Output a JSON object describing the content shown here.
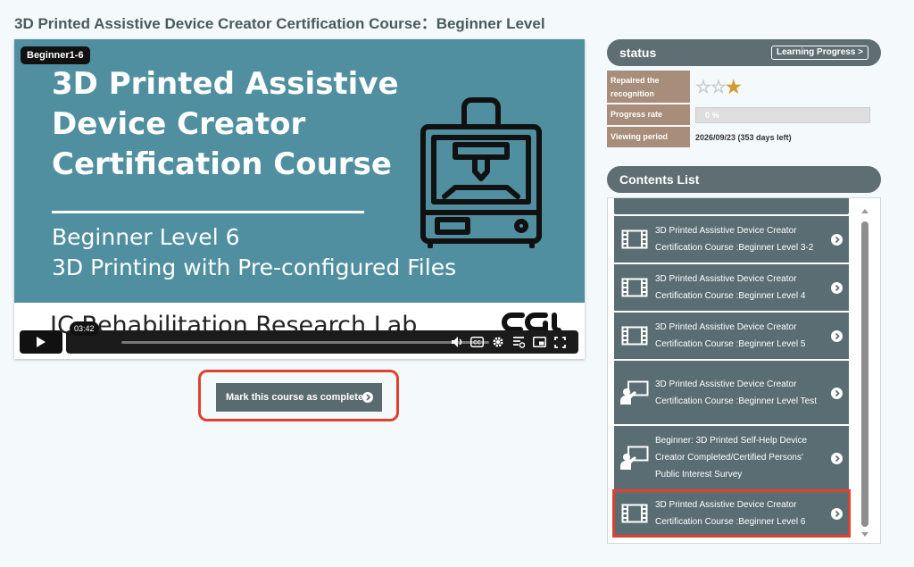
{
  "page": {
    "title": "3D Printed Assistive Device Creator Certification Course：Beginner Level"
  },
  "video": {
    "badge": "Beginner1-6",
    "slide_title": "3D Printed Assistive Device Creator Certification Course",
    "slide_subtitle_1": "Beginner Level 6",
    "slide_subtitle_2": "3D Printing with Pre-configured Files",
    "lab_name": "IC Rehabilitation Research Lab",
    "time": "03:42",
    "icons": [
      "play-icon",
      "volume-icon",
      "captions-icon",
      "settings-gear-icon",
      "watch-later-icon",
      "pip-icon",
      "fullscreen-icon"
    ]
  },
  "actions": {
    "mark_complete": "Mark this course as complete"
  },
  "status": {
    "header": "status",
    "progress_link": "Learning Progress >",
    "rows": {
      "recognition_label": "Repaired the recognition",
      "stars_filled": 1,
      "stars_total": 3,
      "progress_label": "Progress rate",
      "progress_value": "0 %",
      "period_label": "Viewing period",
      "period_value": "2026/09/23 (353 days left)"
    }
  },
  "contents": {
    "header": "Contents List",
    "items": [
      {
        "icon": "film-icon",
        "label": "3D Printed Assistive Device Creator Certification Course :Beginner Level 3-2"
      },
      {
        "icon": "film-icon",
        "label": "3D Printed Assistive Device Creator Certification Course :Beginner Level 4"
      },
      {
        "icon": "film-icon",
        "label": "3D Printed Assistive Device Creator Certification Course :Beginner Level 5"
      },
      {
        "icon": "presenter-icon",
        "label": "3D Printed Assistive Device Creator Certification Course :Beginner Level Test"
      },
      {
        "icon": "presenter-icon",
        "label": "Beginner: 3D Printed Self-Help Device Creator Completed/Certified Persons' Public Interest Survey"
      },
      {
        "icon": "film-icon",
        "label": "3D Printed Assistive Device Creator Certification Course :Beginner Level 6",
        "active": true
      }
    ]
  },
  "colors": {
    "accent_red": "#e0402e",
    "slate": "#5a6d72",
    "teal": "#4f8fa0",
    "tan": "#a78d7a",
    "star_gold": "#d39a2e"
  }
}
